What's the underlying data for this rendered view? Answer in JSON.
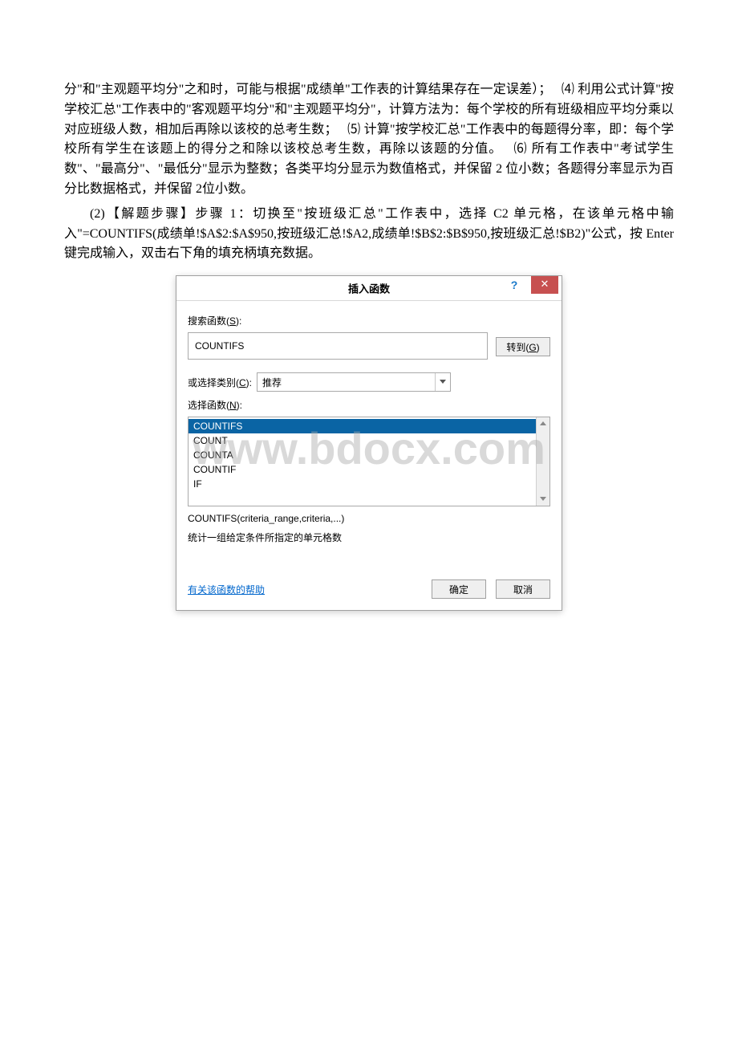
{
  "paragraphs": {
    "p1_a": "分\"和\"主观题平均分\"之和时，可能与根据\"成绩单\"工作表的计算结果存在一定误差）；　",
    "p1_n4": "⑷",
    "p1_b": " 利用公式计算\"按学校汇总\"工作表中的\"客观题平均分\"和\"主观题平均分\"，计算方法为：每个学校的所有班级相应平均分乘以对应班级人数，相加后再除以该校的总考生数；　",
    "p1_n5": "⑸",
    "p1_c": " 计算\"按学校汇总\"工作表中的每题得分率，即：每个学校所有学生在该题上的得分之和除以该校总考生数，再除以该题的分值。　",
    "p1_n6": "⑹",
    "p1_d": " 所有工作表中\"考试学生数\"、\"最高分\"、\"最低分\"显示为整数；各类平均分显示为数值格式，并保留 2 位小数；各题得分率显示为百分比数据格式，并保留 2位小数。",
    "p2": "(2)【解题步骤】步骤 1：切换至\"按班级汇总\"工作表中，选择 C2 单元格，在该单元格中输入\"=COUNTIFS(成绩单!$A$2:$A$950,按班级汇总!$A2,成绩单!$B$2:$B$950,按班级汇总!$B2)\"公式，按 Enter 键完成输入，双击右下角的填充柄填充数据。"
  },
  "dialog": {
    "title": "插入函数",
    "search_label_pre": "搜索函数(",
    "search_label_letter": "S",
    "search_label_post": "):",
    "search_value": "COUNTIFS",
    "go_btn_pre": "转到(",
    "go_btn_letter": "G",
    "go_btn_post": ")",
    "category_label_pre": "或选择类别(",
    "category_label_letter": "C",
    "category_label_post": "):",
    "category_value": "推荐",
    "select_label_pre": "选择函数(",
    "select_label_letter": "N",
    "select_label_post": "):",
    "list": {
      "i0": "COUNTIFS",
      "i1": "COUNT",
      "i2": "COUNTA",
      "i3": "COUNTIF",
      "i4": "IF"
    },
    "syntax": "COUNTIFS(criteria_range,criteria,...)",
    "desc": "统计一组给定条件所指定的单元格数",
    "help_link": "有关该函数的帮助",
    "ok": "确定",
    "cancel": "取消"
  },
  "watermark": "www.bdocx.com"
}
